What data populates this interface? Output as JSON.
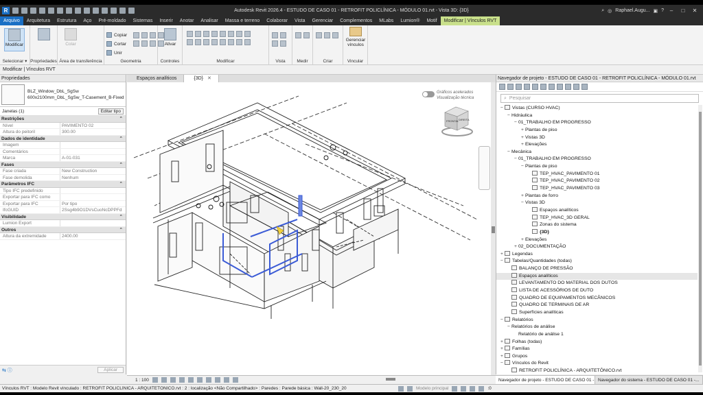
{
  "title_bar": {
    "title": "Autodesk Revit 2026.4 - ESTUDO DE CASO 01 - RETROFIT POLICLÍNICA - MÓDULO 01.rvt - Vista 3D: {3D}",
    "user": "Raphael.Augu...",
    "logo": "R"
  },
  "menu": {
    "items": [
      "Arquivo",
      "Arquitetura",
      "Estrutura",
      "Aço",
      "Pré-moldado",
      "Sistemas",
      "Inserir",
      "Anotar",
      "Analisar",
      "Massa e terreno",
      "Colaborar",
      "Vista",
      "Gerenciar",
      "Complementos",
      "MLabs",
      "Lumion®",
      "Motif",
      "Modificar | Vínculos RVT"
    ]
  },
  "ribbon": {
    "modify_label": "Modificar",
    "select_label": "Selecionar",
    "properties_label": "Propriedades",
    "clipboard_label": "Área de transferência",
    "copy_label": "Copiar",
    "cut_label": "Cortar",
    "join_label": "Unir",
    "paste_label": "Colar",
    "geometry_label": "Geometria",
    "controls_label": "Controles",
    "activate_label": "Ativar",
    "modify_group_label": "Modificar",
    "view_label": "Vista",
    "measure_label": "Medir",
    "create_label": "Criar",
    "manage_links_label": "Gerenciar vínculos",
    "link_label": "Vincular"
  },
  "options_bar": {
    "text": "Modificar | Vínculos RVT"
  },
  "properties": {
    "title": "Propriedades",
    "type_name_1": "BLZ_Window_DbL_SgSw",
    "type_name_2": "600x2100mm_DbL_SgSw_T-Casement_B-Fixed",
    "instance_label": "Janelas (1)",
    "edit_type": "Editar tipo",
    "sections": [
      {
        "name": "Restrições",
        "rows": [
          [
            "Nível",
            "PAVIMENTO 02"
          ],
          [
            "Altura do peitoril",
            "300.00"
          ]
        ]
      },
      {
        "name": "Dados de identidade",
        "rows": [
          [
            "Imagem",
            ""
          ],
          [
            "Comentários",
            ""
          ],
          [
            "Marca",
            "A-01-031"
          ]
        ]
      },
      {
        "name": "Fases",
        "rows": [
          [
            "Fase criada",
            "New Construction"
          ],
          [
            "Fase demolida",
            "Nenhum"
          ]
        ]
      },
      {
        "name": "Parâmetros IFC",
        "rows": [
          [
            "Tipo IFC predefinido",
            ""
          ],
          [
            "Exportar para IFC como",
            ""
          ],
          [
            "Exportar para IFC",
            "Por tipo"
          ],
          [
            "IfcGUID",
            "2Ssg4b9O1DVsCuoNcDPPFd"
          ]
        ]
      },
      {
        "name": "Visibilidade",
        "rows": [
          [
            "Lumion Export",
            ""
          ]
        ]
      },
      {
        "name": "Outros",
        "rows": [
          [
            "Altura da extremidade",
            "2400.00"
          ]
        ]
      }
    ],
    "apply_label": "Aplicar"
  },
  "view_tabs": [
    {
      "label": "Espaços analíticos"
    },
    {
      "label": "{3D}"
    }
  ],
  "viewport": {
    "toggle_line1": "Gráficos acelerados",
    "toggle_line2": "Visualização técnica",
    "cube_front": "FRONTAL",
    "cube_right": "DIREITA",
    "scale": "1 : 100"
  },
  "navigator": {
    "title": "Navegador de projeto - ESTUDO DE CASO 01 - RETROFIT POLICLÍNICA - MÓDULO 01.rvt",
    "search_placeholder": "Pesquisar",
    "nodes": [
      {
        "t": "−",
        "l": 0,
        "i": 1,
        "text": "Vistas (CURSO HVAC)"
      },
      {
        "t": "−",
        "l": 1,
        "i": 0,
        "text": "Hidráulica"
      },
      {
        "t": "−",
        "l": 2,
        "i": 0,
        "text": "01_TRABALHO EM PROGRESSO"
      },
      {
        "t": "+",
        "l": 3,
        "i": 0,
        "text": "Plantas de piso"
      },
      {
        "t": "+",
        "l": 3,
        "i": 0,
        "text": "Vistas 3D"
      },
      {
        "t": "+",
        "l": 3,
        "i": 0,
        "text": "Elevações"
      },
      {
        "t": "−",
        "l": 1,
        "i": 0,
        "text": "Mecânica"
      },
      {
        "t": "−",
        "l": 2,
        "i": 0,
        "text": "01_TRABALHO EM PROGRESSO"
      },
      {
        "t": "−",
        "l": 3,
        "i": 0,
        "text": "Plantas de piso"
      },
      {
        "t": "",
        "l": 4,
        "i": 1,
        "text": "TEP_HVAC_PAVIMENTO 01"
      },
      {
        "t": "",
        "l": 4,
        "i": 1,
        "text": "TEP_HVAC_PAVIMENTO 02"
      },
      {
        "t": "",
        "l": 4,
        "i": 1,
        "text": "TEP_HVAC_PAVIMENTO 03"
      },
      {
        "t": "+",
        "l": 3,
        "i": 0,
        "text": "Plantas de forro"
      },
      {
        "t": "−",
        "l": 3,
        "i": 0,
        "text": "Vistas 3D"
      },
      {
        "t": "",
        "l": 4,
        "i": 1,
        "text": "Espaços analíticos"
      },
      {
        "t": "",
        "l": 4,
        "i": 1,
        "text": "TEP_HVAC_3D GERAL"
      },
      {
        "t": "",
        "l": 4,
        "i": 1,
        "text": "Zonas do sistema"
      },
      {
        "t": "",
        "l": 4,
        "i": 1,
        "text": "{3D}",
        "bold": true
      },
      {
        "t": "+",
        "l": 3,
        "i": 0,
        "text": "Elevações"
      },
      {
        "t": "+",
        "l": 2,
        "i": 0,
        "text": "02_DOCUMENTAÇÃO"
      },
      {
        "t": "+",
        "l": 0,
        "i": 1,
        "text": "Legendas"
      },
      {
        "t": "−",
        "l": 0,
        "i": 1,
        "text": "Tabelas/Quantidades (todas)"
      },
      {
        "t": "",
        "l": 1,
        "i": 1,
        "text": "BALANÇO DE PRESSÃO"
      },
      {
        "t": "",
        "l": 1,
        "i": 1,
        "text": "Espaços analíticos",
        "sel": true
      },
      {
        "t": "",
        "l": 1,
        "i": 1,
        "text": "LEVANTAMENTO DO MATERIAL DOS DUTOS"
      },
      {
        "t": "",
        "l": 1,
        "i": 1,
        "text": "LISTA DE ACESSÓRIOS DE DUTO"
      },
      {
        "t": "",
        "l": 1,
        "i": 1,
        "text": "QUADRO DE EQUIPAMENTOS MECÂNICOS"
      },
      {
        "t": "",
        "l": 1,
        "i": 1,
        "text": "QUADRO DE TERMINAIS DE AR"
      },
      {
        "t": "",
        "l": 1,
        "i": 1,
        "text": "Superfícies analíticas"
      },
      {
        "t": "−",
        "l": 0,
        "i": 1,
        "text": "Relatórios"
      },
      {
        "t": "−",
        "l": 1,
        "i": 0,
        "text": "Relatórios de análise"
      },
      {
        "t": "",
        "l": 2,
        "i": 0,
        "text": "Relatório de análise 1"
      },
      {
        "t": "+",
        "l": 0,
        "i": 1,
        "text": "Folhas (todas)"
      },
      {
        "t": "+",
        "l": 0,
        "i": 1,
        "text": "Famílias"
      },
      {
        "t": "+",
        "l": 0,
        "i": 1,
        "text": "Grupos"
      },
      {
        "t": "−",
        "l": 0,
        "i": 1,
        "text": "Vínculos do Revit"
      },
      {
        "t": "",
        "l": 1,
        "i": 1,
        "text": "RETROFIT POLICLÍNICA - ARQUITETÔNICO.rvt"
      }
    ],
    "tab1": "Navegador de projeto - ESTUDO DE CASO 01 -...",
    "tab2": "Navegador do sistema - ESTUDO DE CASO 01 -..."
  },
  "status_bar": {
    "text": "Vínculos RVT : Modelo Revit vinculado : RETROFIT POLICLÍNICA - ARQUITETÔNICO.rvt : 2 : localização <Não Compartilhado> : Paredes : Parede básica : Wall-20_230_20",
    "model": "Modelo principal",
    "count": ":0"
  },
  "colors": {
    "accent": "#1a6fc4",
    "active_tab": "#c9e08b",
    "selection_blue": "#3b5bd6"
  }
}
